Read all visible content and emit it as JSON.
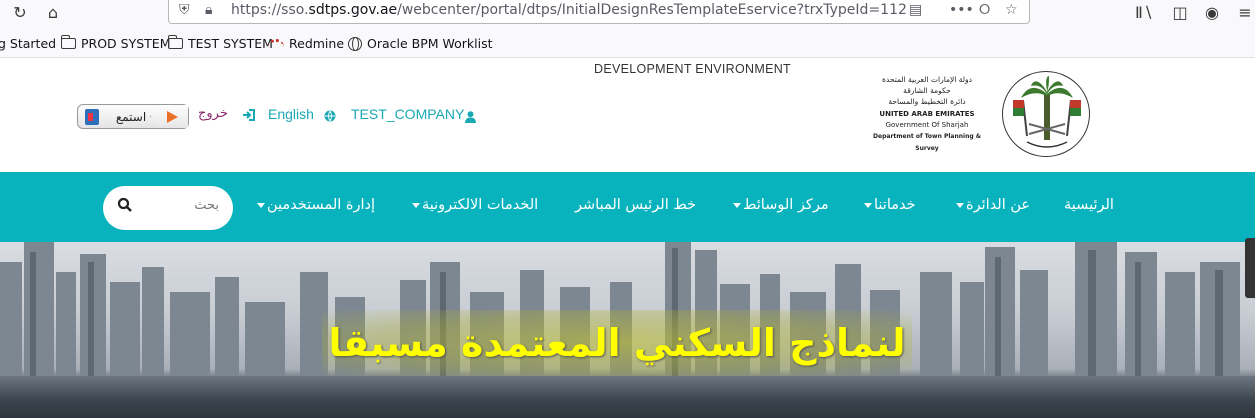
{
  "browser": {
    "url_prefix": "https://sso.",
    "url_domain": "sdtps.gov.ae",
    "url_path": "/webcenter/portal/dtps/InitialDesignResTemplateEservice?trxTypeId=112"
  },
  "bookmarks": [
    {
      "label": "g Started",
      "icon": "none"
    },
    {
      "label": "PROD SYSTEM",
      "icon": "folder-icon"
    },
    {
      "label": "TEST SYSTEM",
      "icon": "folder-icon"
    },
    {
      "label": "Redmine",
      "icon": "redmine-icon"
    },
    {
      "label": "Oracle BPM Worklist",
      "icon": "globe-icon"
    }
  ],
  "header": {
    "environment": "DEVELOPMENT ENVIRONMENT",
    "company": "TEST_COMPANY",
    "language": "English",
    "logout": "خروج",
    "listen": "استمع",
    "logo": {
      "ar_line1": "دولة الإمارات العربية المتحدة",
      "ar_line2": "حكومة الشارقة",
      "ar_line3": "دائرة التخطيط والمساحة",
      "en_line1": "UNITED ARAB EMIRATES",
      "en_line2": "Government Of Sharjah",
      "en_line3": "Department of Town Planning & Survey"
    }
  },
  "nav": {
    "home": "الرئيسية",
    "about": "عن الدائرة",
    "services": "خدماتنا",
    "media": "مركز الوسائط",
    "hotline": "خط الرئيس المباشر",
    "eservices": "الخدمات الالكترونية",
    "user_admin": "إدارة المستخدمين",
    "search_placeholder": "بحث"
  },
  "banner": {
    "title": "لنماذج السكني المعتمدة مسبقا"
  },
  "colors": {
    "brand_teal": "#09b3bd",
    "link_teal": "#1aa9b3",
    "banner_title": "#ffff00",
    "logout_purple": "#8a2b6f"
  }
}
